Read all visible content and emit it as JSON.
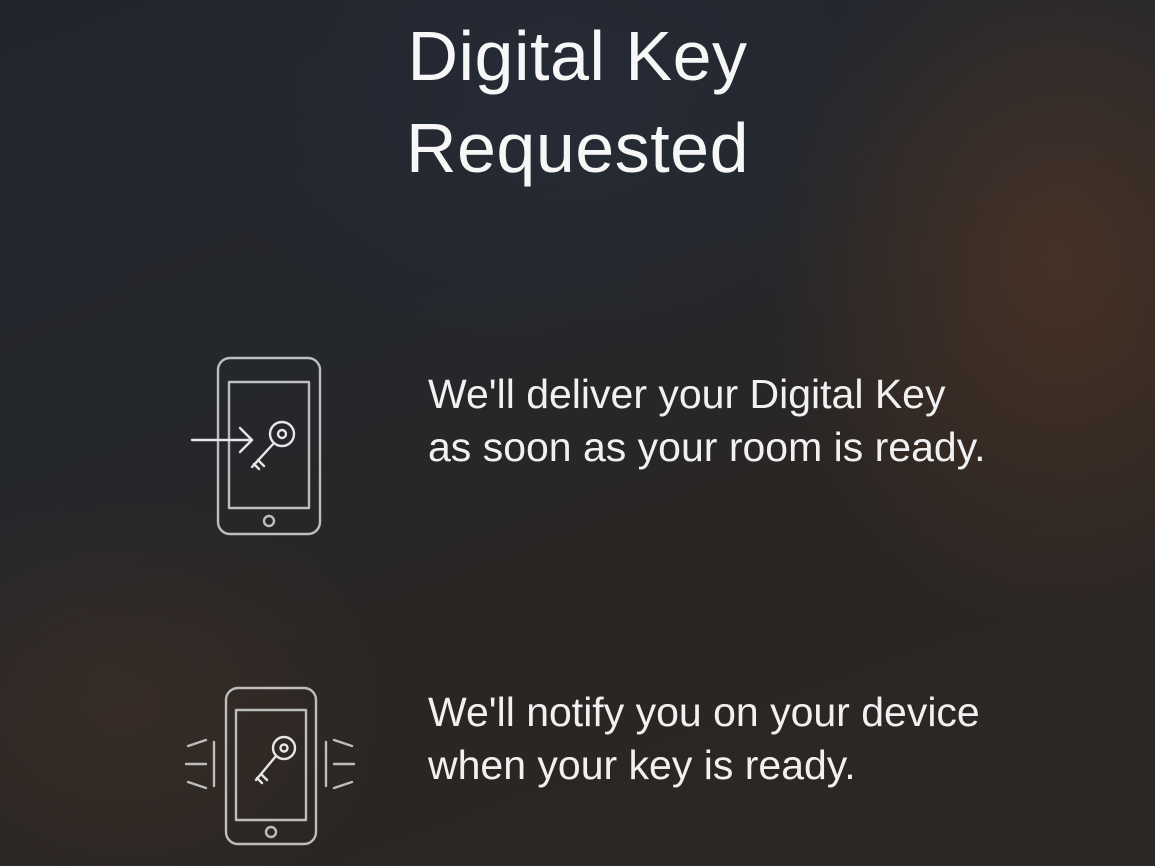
{
  "title": {
    "line1": "Digital Key",
    "line2": "Requested"
  },
  "steps": [
    {
      "icon": "phone-key-delivery-icon",
      "text": "We'll deliver your Digital Key as soon as your room is ready."
    },
    {
      "icon": "phone-key-notification-icon",
      "text": "We'll notify you on your device when your key is ready."
    }
  ],
  "colors": {
    "text": "#f4f4f4",
    "icon_stroke": "#bdbdbd"
  }
}
